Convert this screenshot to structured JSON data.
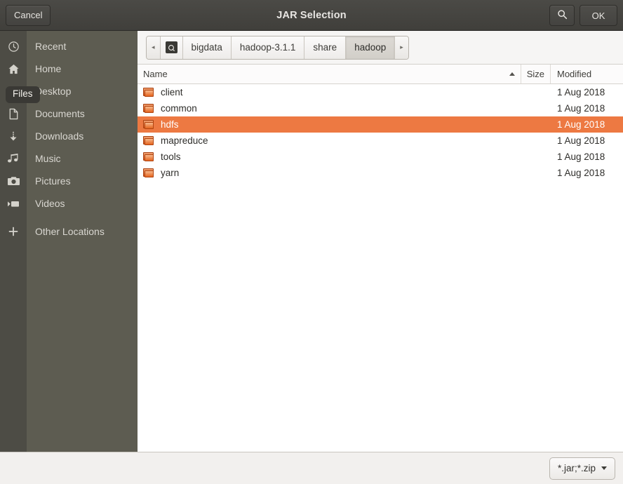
{
  "titlebar": {
    "cancel_label": "Cancel",
    "title": "JAR Selection",
    "search_icon": "search-icon",
    "ok_label": "OK"
  },
  "sidebar": {
    "tooltip": "Files",
    "items": [
      {
        "label": "Recent",
        "icon": "clock-icon"
      },
      {
        "label": "Home",
        "icon": "home-icon"
      },
      {
        "label": "Desktop",
        "icon": "folder-icon"
      },
      {
        "label": "Documents",
        "icon": "document-icon"
      },
      {
        "label": "Downloads",
        "icon": "download-icon"
      },
      {
        "label": "Music",
        "icon": "music-note-icon"
      },
      {
        "label": "Pictures",
        "icon": "camera-icon"
      },
      {
        "label": "Videos",
        "icon": "video-camera-icon"
      },
      {
        "label": "Other Locations",
        "icon": "plus-icon"
      }
    ]
  },
  "pathbar": {
    "prev_arrow": "◂",
    "next_arrow": "▸",
    "disk_icon": "hard-disk-icon",
    "crumbs": [
      {
        "label": "bigdata",
        "active": false
      },
      {
        "label": "hadoop-3.1.1",
        "active": false
      },
      {
        "label": "share",
        "active": false
      },
      {
        "label": "hadoop",
        "active": true
      }
    ]
  },
  "filelist": {
    "columns": {
      "name": "Name",
      "size": "Size",
      "modified": "Modified"
    },
    "sort_column": "Name",
    "sort_direction": "ascending",
    "rows": [
      {
        "name": "client",
        "size": "",
        "modified": "1 Aug 2018",
        "selected": false
      },
      {
        "name": "common",
        "size": "",
        "modified": "1 Aug 2018",
        "selected": false
      },
      {
        "name": "hdfs",
        "size": "",
        "modified": "1 Aug 2018",
        "selected": true
      },
      {
        "name": "mapreduce",
        "size": "",
        "modified": "1 Aug 2018",
        "selected": false
      },
      {
        "name": "tools",
        "size": "",
        "modified": "1 Aug 2018",
        "selected": false
      },
      {
        "name": "yarn",
        "size": "",
        "modified": "1 Aug 2018",
        "selected": false
      }
    ]
  },
  "footer": {
    "filter_label": "*.jar;*.zip"
  },
  "colors": {
    "selection": "#ed7942",
    "titlebar": "#46453f",
    "sidebar": "#5d5c51",
    "sidebar_icon_column": "#4d4c45"
  }
}
